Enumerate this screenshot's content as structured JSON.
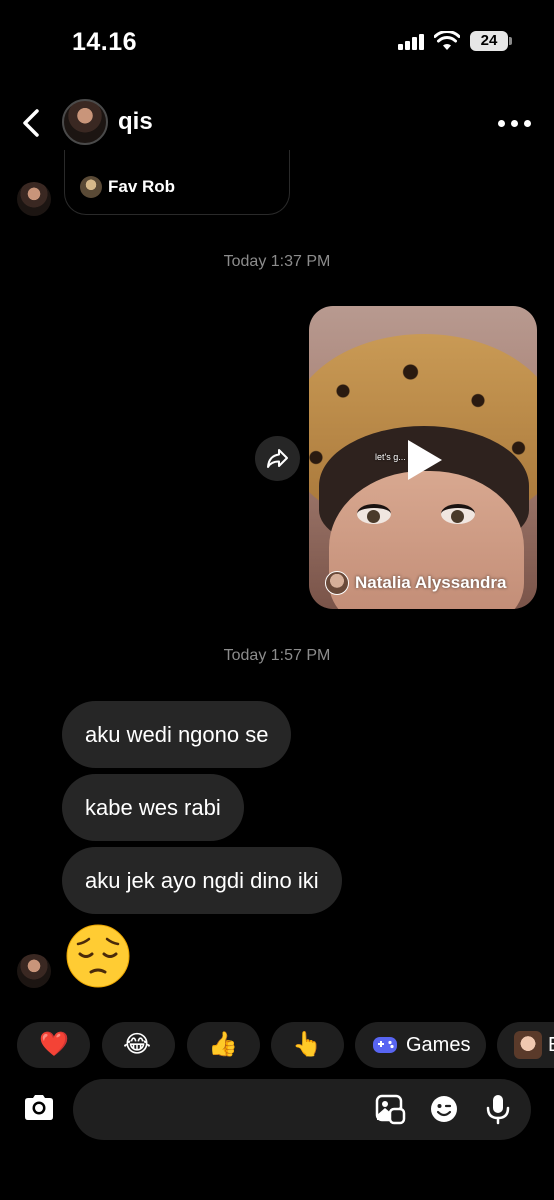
{
  "status_bar": {
    "time": "14.16",
    "battery": "24"
  },
  "header": {
    "name": "qis"
  },
  "previous_share": {
    "label": "Fav Rob"
  },
  "thread": {
    "timestamp_1": "Today 1:37 PM",
    "shared_reel": {
      "caption": "let's g... babe.",
      "author": "Natalia Alyssandra"
    },
    "timestamp_2": "Today 1:57 PM",
    "messages": [
      "aku wedi ngono se",
      "kabe wes rabi",
      "aku jek ayo ngdi dino iki"
    ],
    "emoji_message": "😔"
  },
  "quick_reactions": [
    {
      "emoji": "❤️"
    },
    {
      "emoji": "😂"
    },
    {
      "emoji": "👍"
    },
    {
      "emoji": "👆"
    },
    {
      "label": "Games",
      "icon": "gamepad-icon"
    },
    {
      "label": "E",
      "icon": "avatar-icon"
    }
  ],
  "colors": {
    "background": "#000000",
    "bubble": "#262626",
    "timestamp": "#8c8c8c",
    "accent": "#5865f2"
  }
}
